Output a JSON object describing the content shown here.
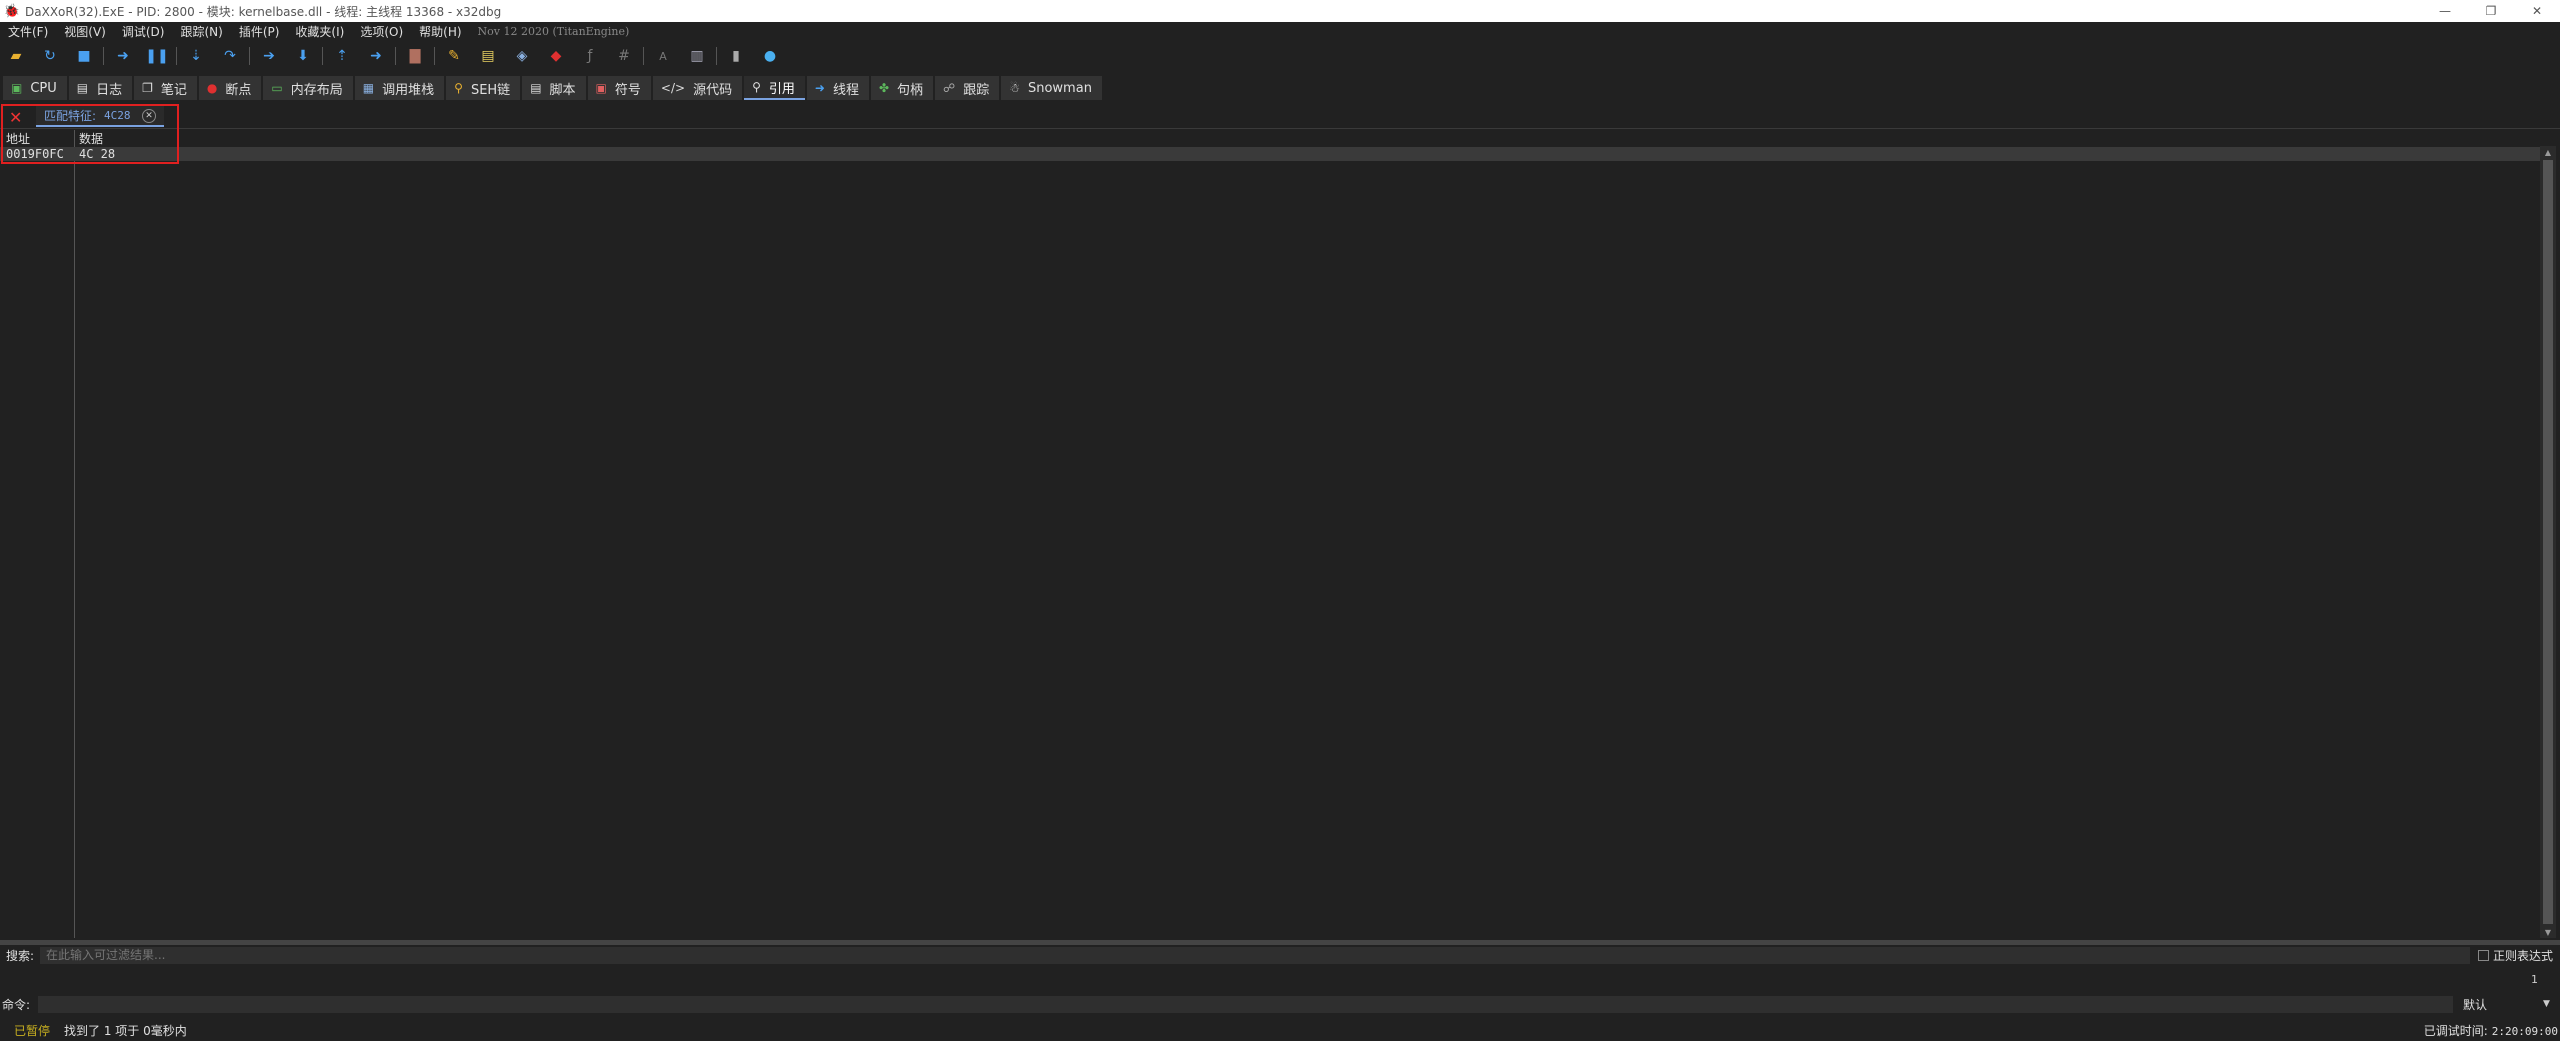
{
  "window": {
    "title": "DaXXoR(32).ExE - PID: 2800 - 模块: kernelbase.dll - 线程: 主线程 13368 - x32dbg",
    "minimize": "—",
    "restore": "❐",
    "close": "✕"
  },
  "menu": {
    "items": [
      "文件(F)",
      "视图(V)",
      "调试(D)",
      "跟踪(N)",
      "插件(P)",
      "收藏夹(I)",
      "选项(O)",
      "帮助(H)"
    ],
    "build": "Nov 12 2020 (TitanEngine)"
  },
  "toolbar": {
    "icons": [
      "open-icon",
      "restart-icon",
      "stop-icon",
      "run-icon",
      "pause-icon",
      "step-into-icon",
      "step-over-icon",
      "run-to-selection-icon",
      "animate-into-icon",
      "execute-till-return-icon",
      "run-to-user-code-icon",
      "scylla-icon",
      "pencil-icon",
      "comment-icon",
      "label-icon",
      "bookmark-icon",
      "function-icon",
      "hash-icon",
      "font-icon",
      "calculator-icon",
      "notes-icon",
      "globe-icon"
    ]
  },
  "tabs": [
    {
      "label": "CPU",
      "icon": "cpu-icon",
      "active": false
    },
    {
      "label": "日志",
      "icon": "log-icon",
      "active": false
    },
    {
      "label": "笔记",
      "icon": "notes-icon",
      "active": false
    },
    {
      "label": "断点",
      "icon": "breakpoint-icon",
      "active": false
    },
    {
      "label": "内存布局",
      "icon": "memory-map-icon",
      "active": false
    },
    {
      "label": "调用堆栈",
      "icon": "callstack-icon",
      "active": false
    },
    {
      "label": "SEH链",
      "icon": "seh-icon",
      "active": false
    },
    {
      "label": "脚本",
      "icon": "script-icon",
      "active": false
    },
    {
      "label": "符号",
      "icon": "symbols-icon",
      "active": false
    },
    {
      "label": "源代码",
      "icon": "source-icon",
      "active": false
    },
    {
      "label": "引用",
      "icon": "references-icon",
      "active": true
    },
    {
      "label": "线程",
      "icon": "threads-icon",
      "active": false
    },
    {
      "label": "句柄",
      "icon": "handles-icon",
      "active": false
    },
    {
      "label": "跟踪",
      "icon": "trace-icon",
      "active": false
    },
    {
      "label": "Snowman",
      "icon": "snowman-icon",
      "active": false
    }
  ],
  "references": {
    "subtab_label": "匹配特征:",
    "subtab_value": "4C28",
    "columns": [
      "地址",
      "数据"
    ],
    "rows": [
      {
        "address": "0019F0FC",
        "data": "4C 28"
      }
    ]
  },
  "search": {
    "label": "搜索:",
    "placeholder": "在此输入可过滤结果...",
    "regex_label": "正则表达式"
  },
  "result_count": "1",
  "command": {
    "label": "命令:",
    "mode": "默认"
  },
  "status": {
    "state": "已暂停",
    "message": "找到了 1 项于 0毫秒内",
    "debug_time_label": "已调试时间:",
    "debug_time": "2:20:09:00"
  },
  "colors": {
    "background": "#212121",
    "accent": "#7aa2e0",
    "paused": "#c8b020",
    "highlight": "#e02020"
  }
}
